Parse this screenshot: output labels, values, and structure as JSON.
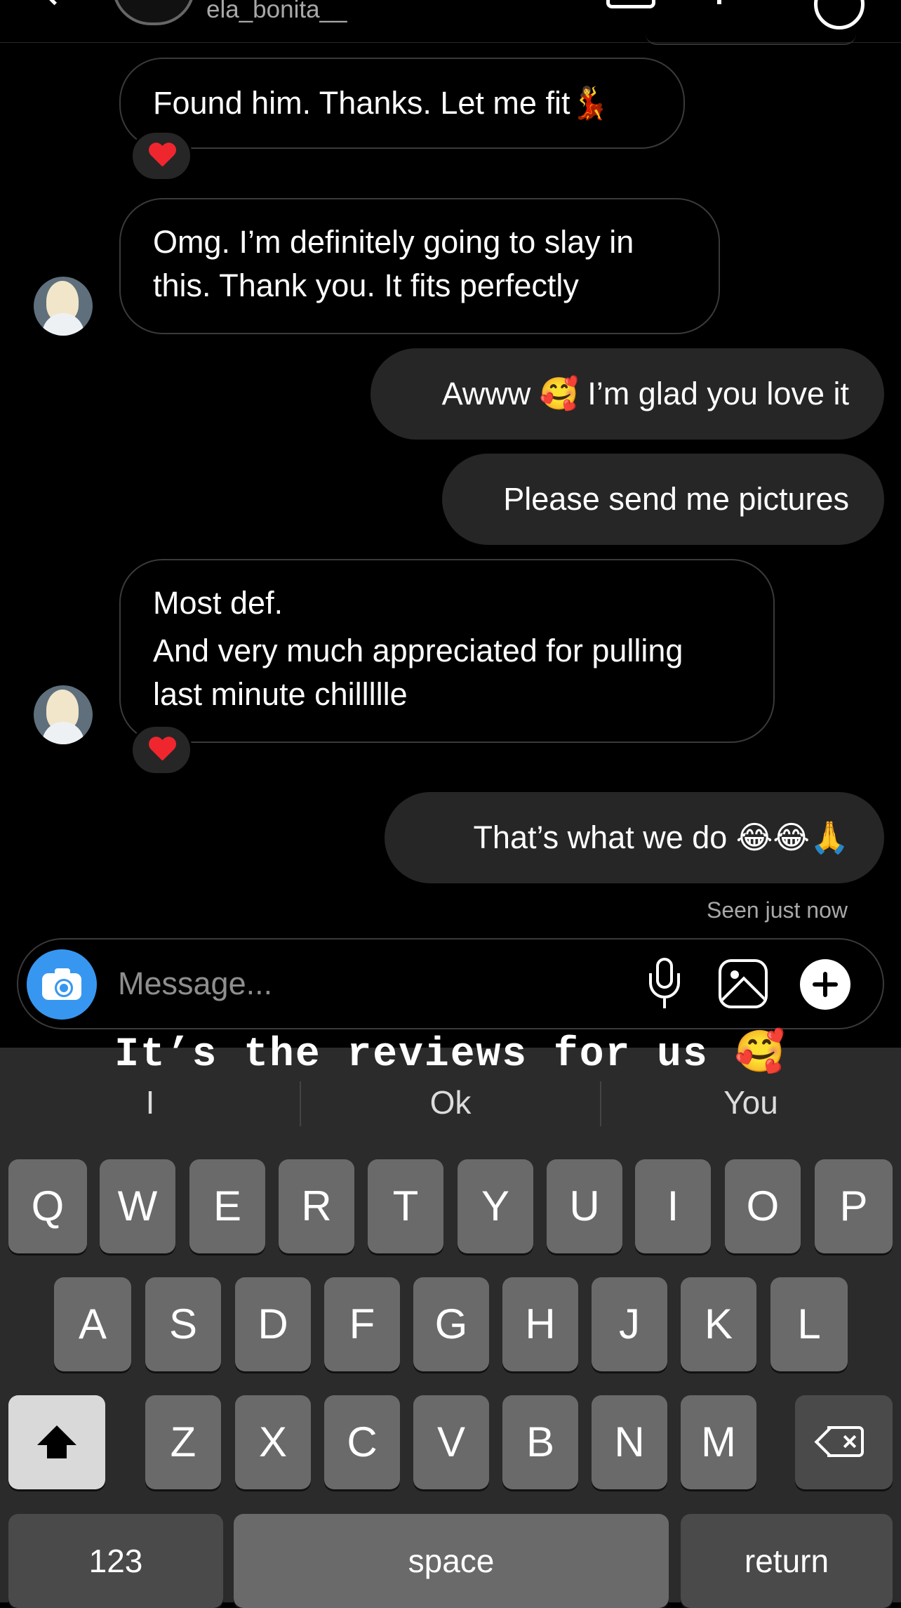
{
  "header": {
    "username": "ela_bonita__",
    "icons": [
      "back-icon",
      "video-call-icon",
      "phone-icon",
      "info-icon"
    ]
  },
  "messages": [
    {
      "sender": "them",
      "lines": [
        "Found him. Thanks. Let me fit💃"
      ],
      "reaction": "heart"
    },
    {
      "sender": "them",
      "lines": [
        "Omg. I’m definitely going to slay in",
        "this. Thank you. It fits perfectly"
      ]
    },
    {
      "sender": "me",
      "lines": [
        "Awww 🥰 I’m glad you love it"
      ]
    },
    {
      "sender": "me",
      "lines": [
        "Please send me pictures"
      ]
    },
    {
      "sender": "them",
      "lines": [
        "Most def.",
        "And very much appreciated for pulling",
        "last minute chillllle"
      ],
      "reaction": "heart"
    },
    {
      "sender": "me",
      "lines": [
        "That’s what we do 😂😂🙏"
      ]
    }
  ],
  "seen_status": "Seen just now",
  "composer": {
    "placeholder": "Message...",
    "icons": [
      "camera-icon",
      "microphone-icon",
      "gallery-icon",
      "plus-icon"
    ],
    "accent": "#3797f0"
  },
  "suggestion_overlay": "It’s the reviews for us 🥰",
  "keyboard": {
    "predictions": [
      "I",
      "Ok",
      "You"
    ],
    "rows": [
      [
        "Q",
        "W",
        "E",
        "R",
        "T",
        "Y",
        "U",
        "I",
        "O",
        "P"
      ],
      [
        "A",
        "S",
        "D",
        "F",
        "G",
        "H",
        "J",
        "K",
        "L"
      ],
      [
        "Z",
        "X",
        "C",
        "V",
        "B",
        "N",
        "M"
      ]
    ],
    "numbers_label": "123",
    "space_label": "space",
    "return_label": "return",
    "icons": [
      "shift-icon",
      "delete-icon"
    ]
  }
}
